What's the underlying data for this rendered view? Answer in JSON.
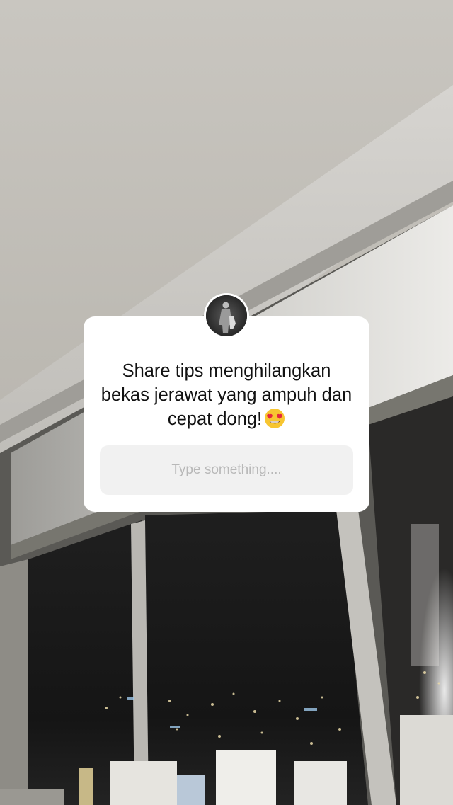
{
  "question": {
    "text": "Share tips menghilangkan bekas jerawat yang ampuh dan cepat dong!",
    "emoji_icon": "heart-eyes-emoji-icon",
    "placeholder": "Type something....",
    "avatar": "profile-avatar"
  },
  "colors": {
    "card": "#ffffff",
    "input_bg": "#f1f1f1",
    "placeholder_text": "#b8b8b8",
    "question_text": "#111111"
  }
}
